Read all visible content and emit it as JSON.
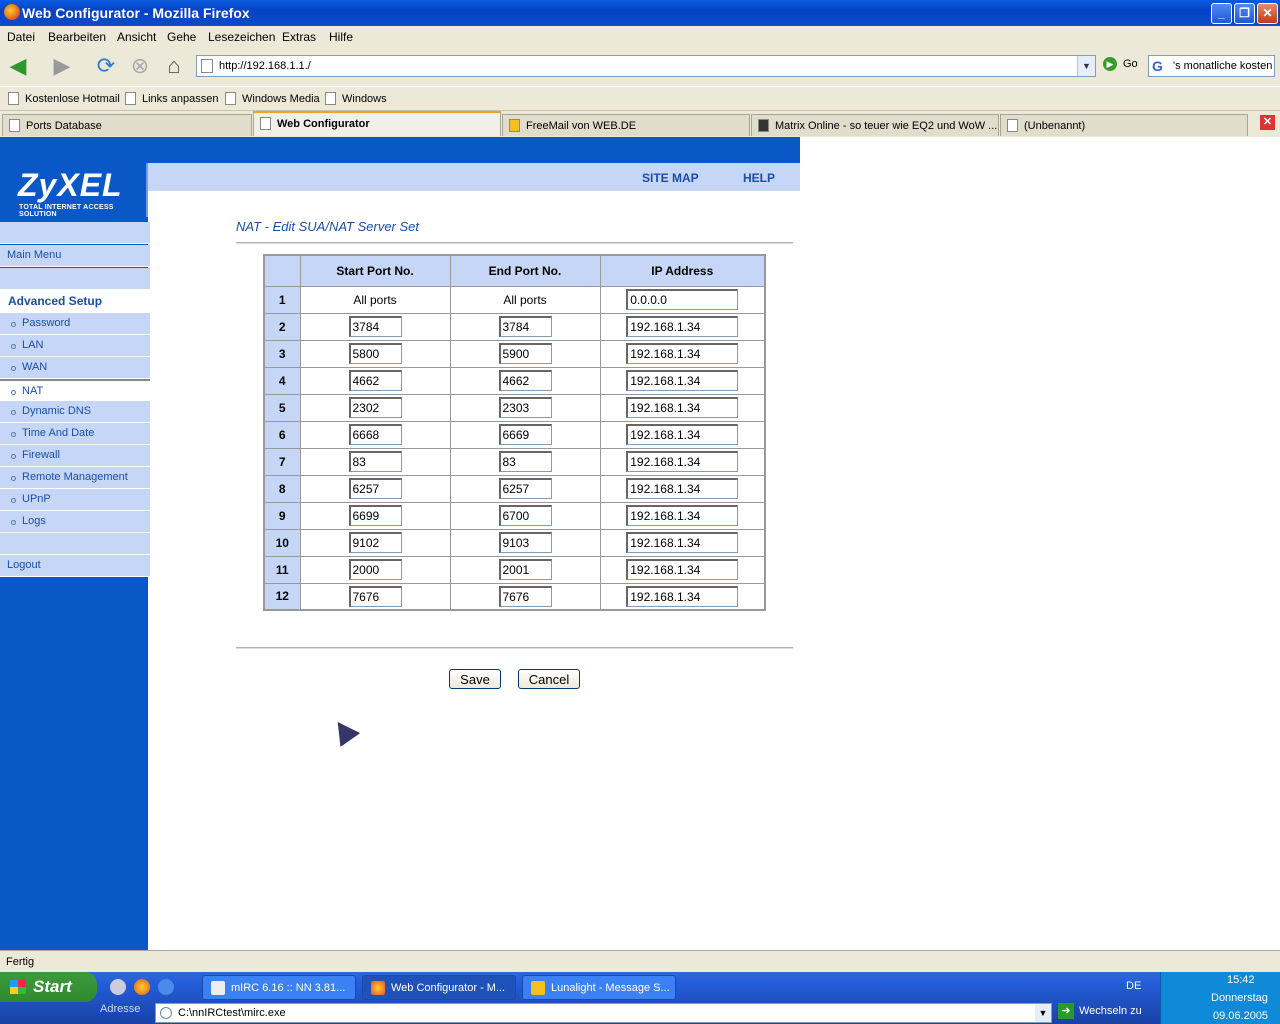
{
  "window": {
    "title": "Web Configurator - Mozilla Firefox",
    "min": "_",
    "max": "❐",
    "close": "✕"
  },
  "menu": [
    "Datei",
    "Bearbeiten",
    "Ansicht",
    "Gehe",
    "Lesezeichen",
    "Extras",
    "Hilfe"
  ],
  "toolbar": {
    "url": "http://192.168.1.1./",
    "go": "Go",
    "search": "'s monatliche kosten"
  },
  "bookmarks": [
    "Kostenlose Hotmail",
    "Links anpassen",
    "Windows Media",
    "Windows"
  ],
  "tabs": [
    {
      "label": "Ports Database",
      "selected": false
    },
    {
      "label": "Web Configurator",
      "selected": true
    },
    {
      "label": "FreeMail von WEB.DE",
      "selected": false
    },
    {
      "label": "Matrix Online - so teuer wie EQ2 und WoW ...",
      "selected": false
    },
    {
      "label": "(Unbenannt)",
      "selected": false
    }
  ],
  "router": {
    "logo": "ZyXEL",
    "tagline": "TOTAL INTERNET ACCESS SOLUTION",
    "sitemap": "SITE MAP",
    "help": "HELP",
    "title": "NAT - Edit SUA/NAT Server Set"
  },
  "sidebar": {
    "main": "Main Menu",
    "section": "Advanced Setup",
    "items": [
      "Password",
      "LAN",
      "WAN",
      "NAT",
      "Dynamic DNS",
      "Time And Date",
      "Firewall",
      "Remote Management",
      "UPnP",
      "Logs"
    ],
    "logout": "Logout"
  },
  "table": {
    "headers": [
      "",
      "Start Port No.",
      "End Port No.",
      "IP Address"
    ],
    "rows": [
      {
        "n": "1",
        "start": "All ports",
        "end": "All ports",
        "ip": "0.0.0.0"
      },
      {
        "n": "2",
        "start": "3784",
        "end": "3784",
        "ip": "192.168.1.34"
      },
      {
        "n": "3",
        "start": "5800",
        "end": "5900",
        "ip": "192.168.1.34"
      },
      {
        "n": "4",
        "start": "4662",
        "end": "4662",
        "ip": "192.168.1.34"
      },
      {
        "n": "5",
        "start": "2302",
        "end": "2303",
        "ip": "192.168.1.34"
      },
      {
        "n": "6",
        "start": "6668",
        "end": "6669",
        "ip": "192.168.1.34"
      },
      {
        "n": "7",
        "start": "83",
        "end": "83",
        "ip": "192.168.1.34"
      },
      {
        "n": "8",
        "start": "6257",
        "end": "6257",
        "ip": "192.168.1.34"
      },
      {
        "n": "9",
        "start": "6699",
        "end": "6700",
        "ip": "192.168.1.34"
      },
      {
        "n": "10",
        "start": "9102",
        "end": "9103",
        "ip": "192.168.1.34"
      },
      {
        "n": "11",
        "start": "2000",
        "end": "2001",
        "ip": "192.168.1.34"
      },
      {
        "n": "12",
        "start": "7676",
        "end": "7676",
        "ip": "192.168.1.34"
      }
    ]
  },
  "buttons": {
    "save": "Save",
    "cancel": "Cancel"
  },
  "status": "Fertig",
  "taskbar": {
    "start": "Start",
    "items": [
      {
        "label": "mIRC 6.16 :: NN 3.81...",
        "active": false
      },
      {
        "label": "Web Configurator - M...",
        "active": true
      },
      {
        "label": "Lunalight - Message S...",
        "active": false
      }
    ],
    "lang": "DE",
    "time": "15:42",
    "day": "Donnerstag",
    "date": "09.06.2005",
    "address_label": "Adresse",
    "address_value": "C:\\nnIRCtest\\mirc.exe",
    "wechseln": "Wechseln zu"
  },
  "colors": {
    "accent": "#0a58c8",
    "light": "#c6d6f6",
    "text": "#1a4ea8"
  }
}
